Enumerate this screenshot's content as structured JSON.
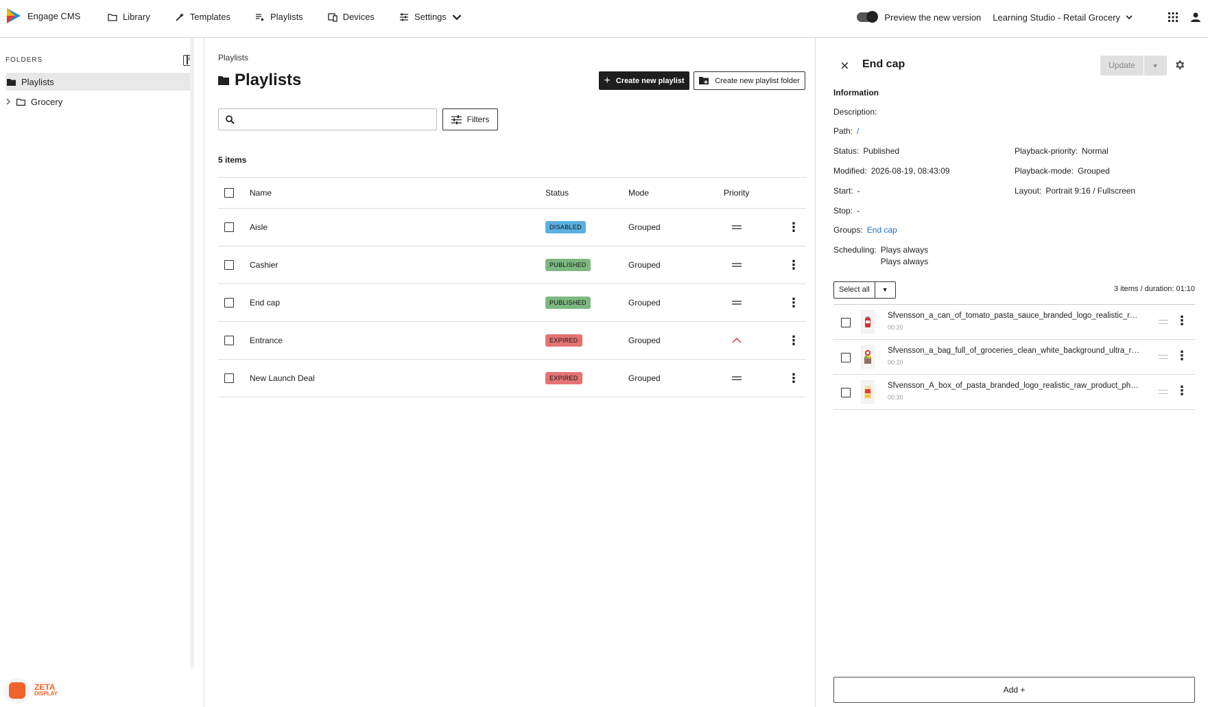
{
  "app": {
    "name": "Engage CMS"
  },
  "nav": {
    "items": [
      {
        "label": "Library",
        "icon": "folder-icon"
      },
      {
        "label": "Templates",
        "icon": "wand-icon"
      },
      {
        "label": "Playlists",
        "icon": "playlist-icon"
      },
      {
        "label": "Devices",
        "icon": "devices-icon"
      },
      {
        "label": "Settings",
        "icon": "sliders-icon"
      }
    ]
  },
  "header": {
    "preview_label": "Preview the new version",
    "org": "Learning Studio - Retail Grocery"
  },
  "sidebar": {
    "title": "FOLDERS",
    "items": [
      {
        "label": "Playlists",
        "selected": true
      },
      {
        "label": "Grocery",
        "selected": false
      }
    ],
    "brand": {
      "name": "ZETA",
      "sub": "DISPLAY"
    }
  },
  "main": {
    "breadcrumb": "Playlists",
    "title": "Playlists",
    "create_button": "Create new playlist",
    "create_folder_button": "Create new playlist folder",
    "search_placeholder": "",
    "filters_label": "Filters",
    "item_count": "5 items",
    "columns": {
      "name": "Name",
      "status": "Status",
      "mode": "Mode",
      "priority": "Priority"
    },
    "rows": [
      {
        "name": "Aisle",
        "status": "DISABLED",
        "mode": "Grouped",
        "priority": "normal"
      },
      {
        "name": "Cashier",
        "status": "PUBLISHED",
        "mode": "Grouped",
        "priority": "normal"
      },
      {
        "name": "End cap",
        "status": "PUBLISHED",
        "mode": "Grouped",
        "priority": "normal"
      },
      {
        "name": "Entrance",
        "status": "EXPIRED",
        "mode": "Grouped",
        "priority": "high"
      },
      {
        "name": "New Launch Deal",
        "status": "EXPIRED",
        "mode": "Grouped",
        "priority": "normal"
      }
    ]
  },
  "colors": {
    "disabled": "#5ab0e0",
    "published": "#7db881",
    "expired": "#e57373",
    "link": "#1a6fc9",
    "brand_orange": "#f0642c"
  },
  "panel": {
    "title": "End cap",
    "update_label": "Update",
    "info_title": "Information",
    "labels": {
      "description": "Description:",
      "path": "Path:",
      "status": "Status:",
      "modified": "Modified:",
      "start": "Start:",
      "stop": "Stop:",
      "groups": "Groups:",
      "scheduling": "Scheduling:",
      "playback_priority": "Playback-priority:",
      "playback_mode": "Playback-mode:",
      "layout": "Layout:"
    },
    "values": {
      "description": "",
      "path": "/",
      "status": "Published",
      "modified": "2026-08-19, 08:43:09",
      "start": "-",
      "stop": "-",
      "groups": "End cap",
      "scheduling_1": "Plays always",
      "scheduling_2": "Plays always",
      "playback_priority": "Normal",
      "playback_mode": "Grouped",
      "layout": "Portrait 9:16 / Fullscreen"
    },
    "select_all_label": "Select all",
    "summary": "3 items /  duration: 01:10",
    "media": [
      {
        "name": "Sfvensson_a_can_of_tomato_pasta_sauce_branded_logo_realistic_raw_product",
        "duration": "00:20"
      },
      {
        "name": "Sfvensson_a_bag_full_of_groceries_clean_white_background_ultra_realistic",
        "duration": "00:20"
      },
      {
        "name": "Sfvensson_A_box_of_pasta_branded_logo_realistic_raw_product_photography",
        "duration": "00:30"
      }
    ],
    "add_label": "Add +"
  }
}
